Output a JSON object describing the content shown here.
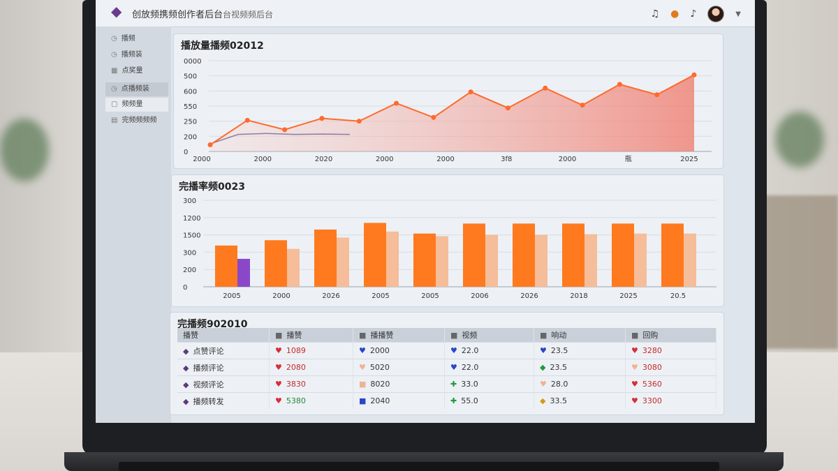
{
  "app": {
    "title": "创放频携频创作者后台",
    "subtitle": "台视频频后台",
    "logo_icon": "eggplant-icon",
    "top_icons": [
      "bell-icon",
      "user-icon",
      "notification-icon"
    ]
  },
  "sidebar": {
    "items": [
      {
        "label": "播频",
        "icon": "clock-icon"
      },
      {
        "label": "播频装",
        "icon": "clock-icon"
      },
      {
        "label": "点奖量",
        "icon": "grid-icon"
      },
      {
        "label": "点播频装",
        "icon": "clock-icon"
      },
      {
        "label": "频频量",
        "icon": "box-icon"
      },
      {
        "label": "完频频频频",
        "icon": "list-icon"
      }
    ],
    "active_index": 4,
    "highlight_index": 3
  },
  "chart_data": [
    {
      "type": "area",
      "title": "播放量播频02012",
      "y_ticks": [
        "0000",
        "500",
        "600",
        "550",
        "250",
        "200",
        "0"
      ],
      "x_ticks": [
        "2000",
        "2000",
        "2020",
        "2000",
        "2000",
        "3f8",
        "2000",
        "瓶",
        "2025"
      ],
      "series": [
        {
          "color": "#ff6a2b",
          "values": [
            35,
            165,
            115,
            175,
            160,
            255,
            180,
            315,
            230,
            335,
            245,
            355,
            300,
            405
          ]
        },
        {
          "color": "#8d7aa6",
          "values": [
            40,
            90,
            95,
            90,
            92,
            90
          ]
        }
      ],
      "ylim": [
        0,
        480
      ]
    },
    {
      "type": "bar",
      "title": "完播率频0023",
      "y_ticks": [
        "300",
        "1200",
        "1500",
        "300",
        "200",
        "0"
      ],
      "x_ticks": [
        "2005",
        "2000",
        "2026",
        "2005",
        "2005",
        "2006",
        "2026",
        "2018",
        "2025",
        "20.5"
      ],
      "series": [
        {
          "name": "",
          "color": "#ff7a1f",
          "values": [
            62,
            70,
            86,
            96,
            80,
            95,
            95,
            95,
            95,
            95
          ]
        },
        {
          "name": "",
          "color": "#f5bd99",
          "values": [
            42,
            57,
            74,
            83,
            76,
            78,
            78,
            79,
            80,
            80
          ]
        }
      ],
      "special_second_bar": {
        "index": 0,
        "color": "#8a48c9"
      },
      "ylim": [
        0,
        130
      ]
    }
  ],
  "table": {
    "title": "完播频902010",
    "headers": [
      "播赞",
      "播赞",
      "播播赞",
      "视频",
      "响动",
      "回购"
    ],
    "rows": [
      {
        "label": "点赞评论",
        "cells": [
          {
            "icon": "heart-icon",
            "cls": "heart",
            "glyph": "♥",
            "value": "1089"
          },
          {
            "icon": "blue-heart-icon",
            "cls": "blue",
            "glyph": "♥",
            "value": "2000"
          },
          {
            "icon": "blue-heart-icon",
            "cls": "blue",
            "glyph": "♥",
            "value": "22.0"
          },
          {
            "icon": "blue-heart-icon",
            "cls": "blue",
            "glyph": "♥",
            "value": "23.5"
          },
          {
            "icon": "heart-icon",
            "cls": "heart",
            "glyph": "♥",
            "value": "3280"
          }
        ]
      },
      {
        "label": "播频评论",
        "cells": [
          {
            "icon": "heart-icon",
            "cls": "heart",
            "glyph": "♥",
            "value": "2080"
          },
          {
            "icon": "peach-heart-icon",
            "cls": "peach",
            "glyph": "♥",
            "value": "5020"
          },
          {
            "icon": "blue-heart-icon",
            "cls": "blue",
            "glyph": "♥",
            "value": "22.0"
          },
          {
            "icon": "green-diamond-icon",
            "cls": "green",
            "glyph": "◆",
            "value": "23.5"
          },
          {
            "icon": "peach-heart-icon",
            "cls": "peach",
            "glyph": "♥",
            "value": "3080"
          }
        ]
      },
      {
        "label": "视频评论",
        "cells": [
          {
            "icon": "heart-icon",
            "cls": "heart",
            "glyph": "♥",
            "value": "3830"
          },
          {
            "icon": "peach-square-icon",
            "cls": "peach",
            "glyph": "■",
            "value": "8020"
          },
          {
            "icon": "green-plus-icon",
            "cls": "green",
            "glyph": "✚",
            "value": "33.0"
          },
          {
            "icon": "peach-heart-icon",
            "cls": "peach",
            "glyph": "♥",
            "value": "28.0"
          },
          {
            "icon": "heart-icon",
            "cls": "heart",
            "glyph": "♥",
            "value": "5360"
          }
        ]
      },
      {
        "label": "播频转发",
        "cells": [
          {
            "icon": "heart-icon",
            "cls": "heart",
            "glyph": "♥",
            "value": "5380",
            "num_cls": "num-green"
          },
          {
            "icon": "blue-square-icon",
            "cls": "blue",
            "glyph": "■",
            "value": "2040"
          },
          {
            "icon": "green-plus-icon",
            "cls": "green",
            "glyph": "✚",
            "value": "55.0"
          },
          {
            "icon": "gold-shield-icon",
            "cls": "gold",
            "glyph": "◆",
            "value": "33.5"
          },
          {
            "icon": "heart-icon",
            "cls": "heart",
            "glyph": "♥",
            "value": "3300"
          }
        ]
      }
    ]
  }
}
